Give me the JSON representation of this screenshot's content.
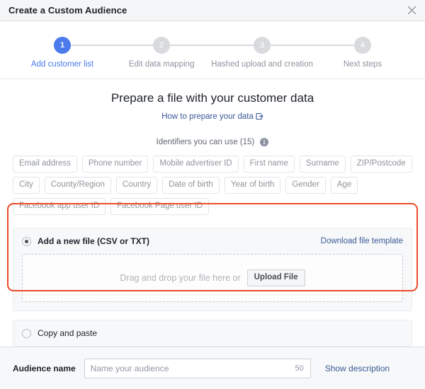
{
  "window": {
    "title": "Create a Custom Audience",
    "close_icon": "close-icon"
  },
  "stepper": {
    "steps": [
      {
        "number": "1",
        "label": "Add customer list",
        "active": true
      },
      {
        "number": "2",
        "label": "Edit data mapping",
        "active": false
      },
      {
        "number": "3",
        "label": "Hashed upload and creation",
        "active": false
      },
      {
        "number": "4",
        "label": "Next steps",
        "active": false
      }
    ],
    "active_color": "#4a7aec",
    "inactive_color": "#d8dade"
  },
  "main": {
    "heading": "Prepare a file with your customer data",
    "help_link": "How to prepare your data",
    "help_link_icon": "external-link-icon",
    "identifiers_label": "Identifiers you can use (15)",
    "identifiers_info_icon": "info-icon",
    "identifiers": [
      "Email address",
      "Phone number",
      "Mobile advertiser ID",
      "First name",
      "Surname",
      "ZIP/Postcode",
      "City",
      "County/Region",
      "Country",
      "Date of birth",
      "Year of birth",
      "Gender",
      "Age",
      "Facebook app user ID",
      "Facebook Page user ID"
    ]
  },
  "upload_option": {
    "radio_label": "Add a new file (CSV or TXT)",
    "selected": true,
    "download_template_link": "Download file template",
    "drop_text": "Drag and drop your file here or",
    "upload_button": "Upload File",
    "highlight_color": "#ec4a29"
  },
  "paste_option": {
    "radio_label": "Copy and paste",
    "selected": false
  },
  "footer": {
    "audience_name_label": "Audience name",
    "audience_name_value": "",
    "audience_name_placeholder": "Name your audience",
    "char_limit": "50",
    "show_description_link": "Show description"
  }
}
